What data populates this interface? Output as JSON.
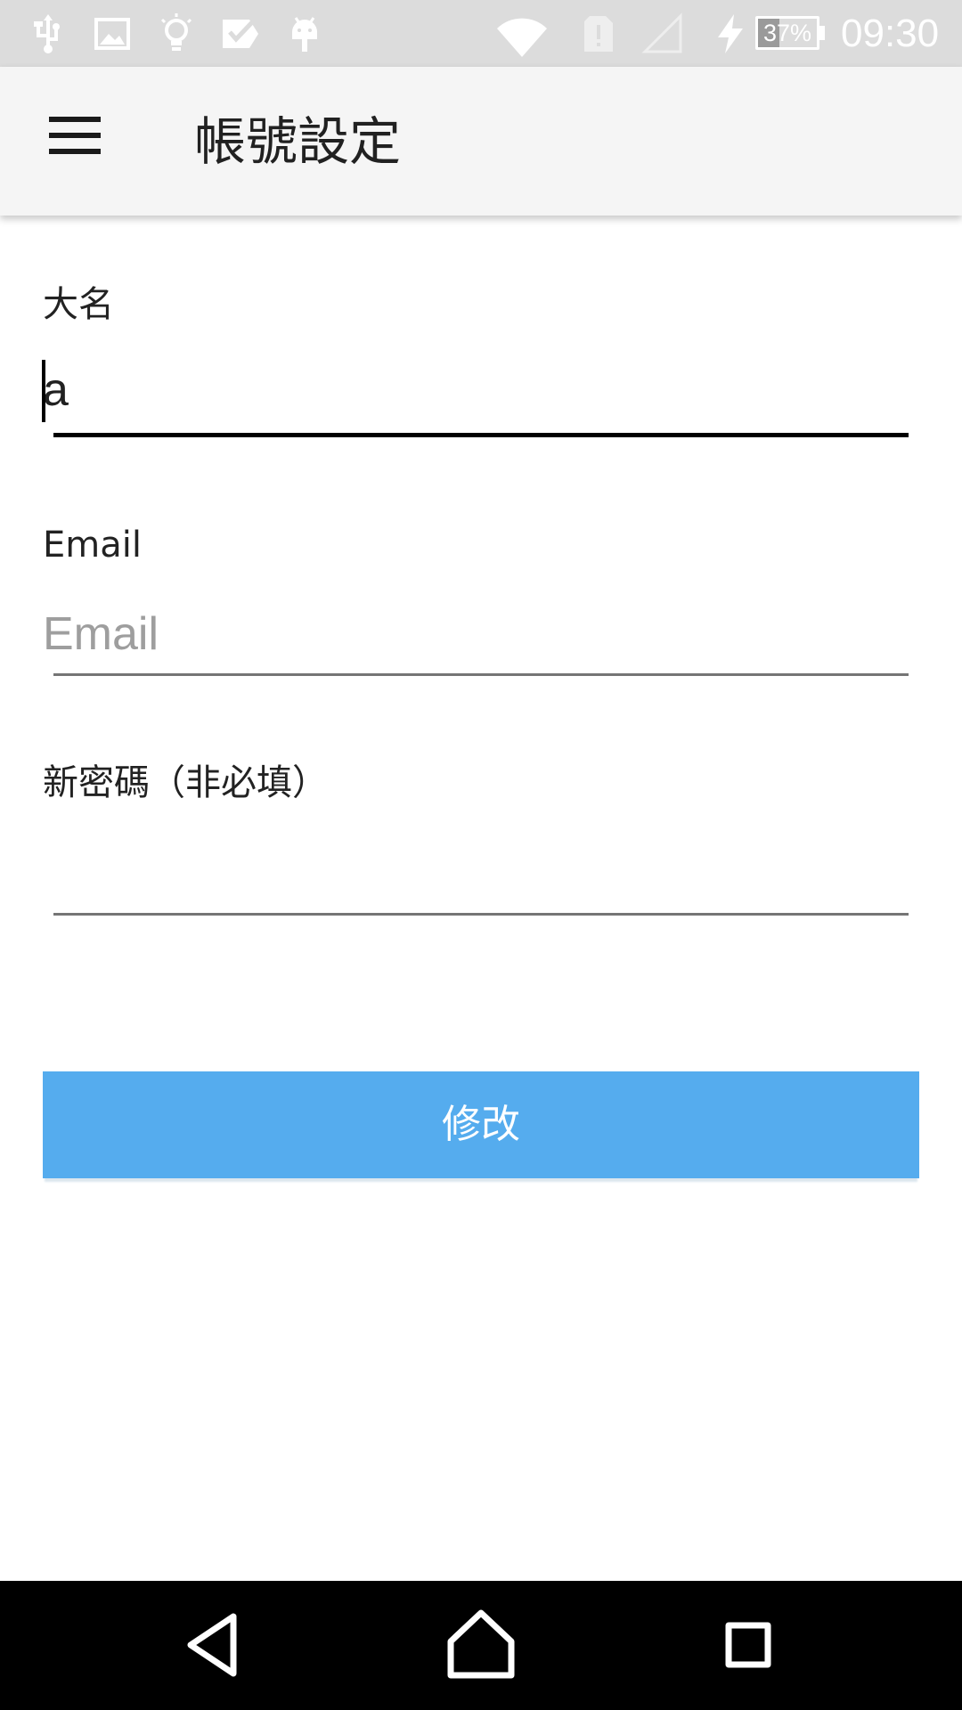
{
  "status_bar": {
    "left_icons": [
      "usb-icon",
      "image-icon",
      "lightbulb-icon",
      "checkbox-icon",
      "android-icon"
    ],
    "right_icons": [
      "wifi-icon",
      "sim-alert-icon",
      "no-signal-icon",
      "charging-bolt-icon"
    ],
    "battery_percent": 37,
    "battery_label": "37%",
    "time": "09:30"
  },
  "app_bar": {
    "menu_icon": "hamburger-menu-icon",
    "title": "帳號設定"
  },
  "form": {
    "name": {
      "label": "大名",
      "value": "a",
      "focused": true
    },
    "email": {
      "label": "Email",
      "value": "",
      "placeholder": "Email"
    },
    "password": {
      "label": "新密碼（非必填）",
      "value": ""
    },
    "submit_label": "修改"
  },
  "nav_bar": {
    "buttons": [
      "back-icon",
      "home-icon",
      "recents-icon"
    ]
  },
  "colors": {
    "status_bar_bg": "#dcdcdc",
    "app_bar_bg": "#f5f5f5",
    "accent_button": "#55acee",
    "nav_bar_bg": "#000000",
    "focused_underline": "#000000",
    "idle_underline": "#757575",
    "placeholder": "#9e9e9e"
  }
}
